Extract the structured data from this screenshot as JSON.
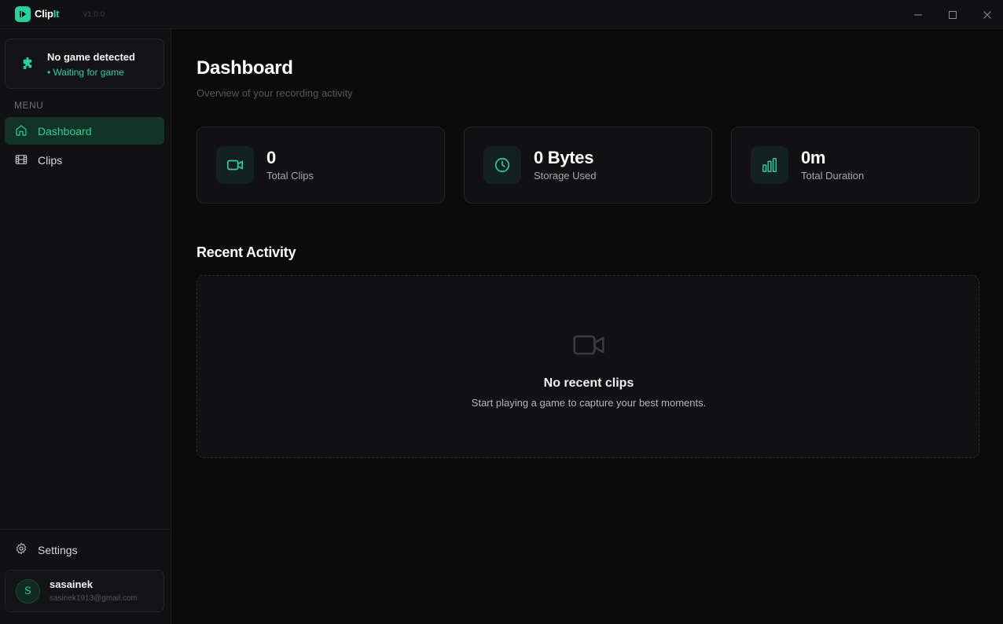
{
  "app": {
    "name_main": "Clip",
    "name_accent": "It",
    "version": "v1.0.0"
  },
  "window_controls": [
    "minimize",
    "maximize",
    "close"
  ],
  "sidebar": {
    "game_status": {
      "title": "No game detected",
      "status": "• Waiting for game",
      "icon": "puzzle-icon"
    },
    "menu_label": "MENU",
    "items": [
      {
        "label": "Dashboard",
        "icon": "home-icon",
        "active": true
      },
      {
        "label": "Clips",
        "icon": "film-icon",
        "active": false
      }
    ],
    "settings_label": "Settings",
    "user": {
      "initial": "S",
      "name": "sasainek",
      "email": "sasinek1913@gmail.com"
    }
  },
  "main": {
    "title": "Dashboard",
    "subtitle": "Overview of your recording activity",
    "stats": [
      {
        "value": "0",
        "label": "Total Clips",
        "icon": "video-icon"
      },
      {
        "value": "0 Bytes",
        "label": "Storage Used",
        "icon": "clock-icon"
      },
      {
        "value": "0m",
        "label": "Total Duration",
        "icon": "bar-chart-icon"
      }
    ],
    "recent": {
      "title": "Recent Activity",
      "empty_title": "No recent clips",
      "empty_subtitle": "Start playing a game to capture your best moments.",
      "icon": "video-icon"
    }
  },
  "colors": {
    "accent": "#22d39b",
    "background": "#0b0b0c",
    "panel": "#111113",
    "active_nav": "#123328"
  }
}
